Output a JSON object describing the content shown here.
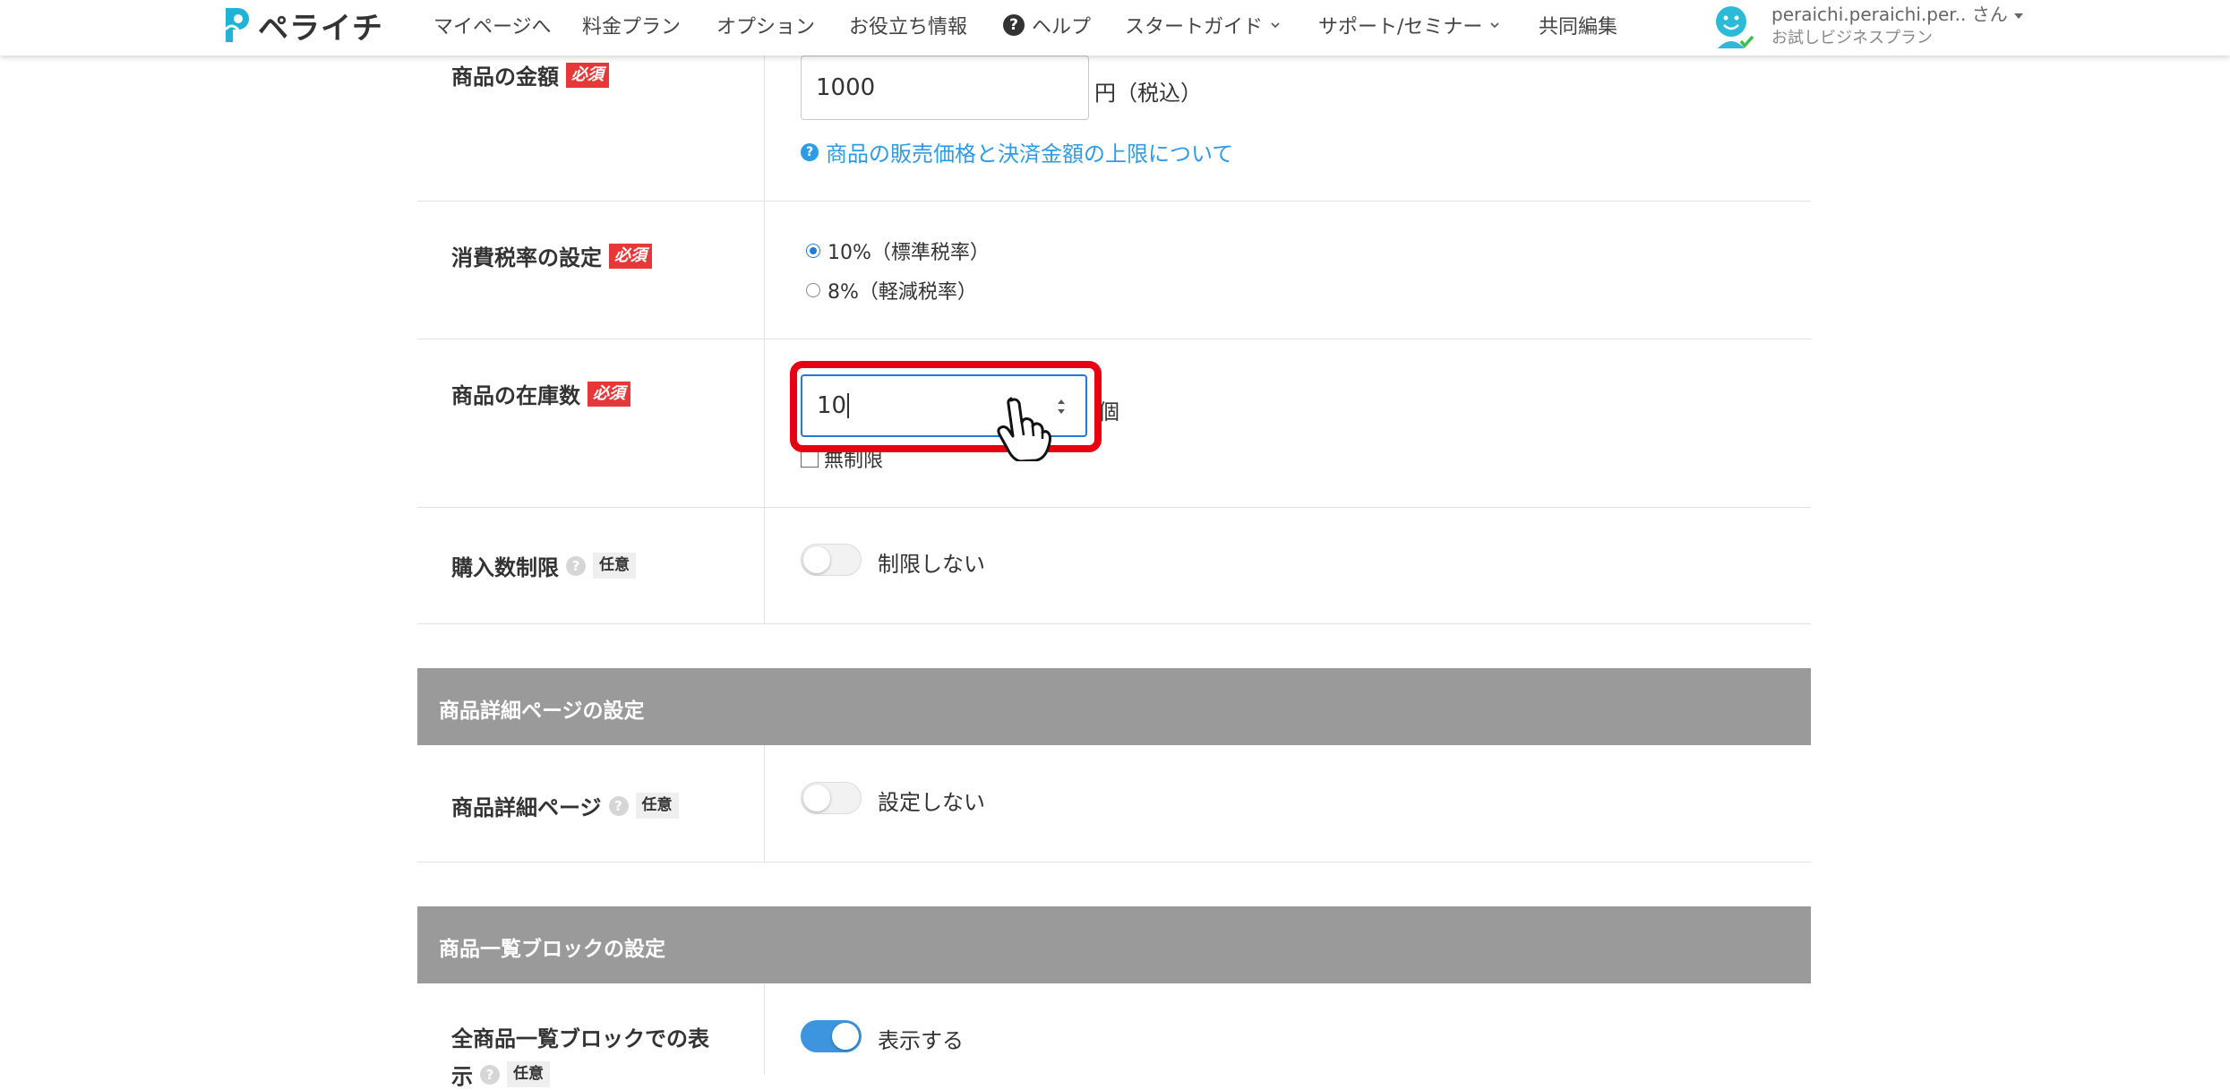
{
  "header": {
    "logo_text": "ペライチ",
    "nav": [
      {
        "label": "マイページへ"
      },
      {
        "label": "料金プラン"
      },
      {
        "label": "オプション"
      },
      {
        "label": "お役立ち情報"
      },
      {
        "label": "ヘルプ"
      },
      {
        "label": "スタートガイド"
      },
      {
        "label": "サポート/セミナー"
      },
      {
        "label": "共同編集"
      }
    ],
    "user_name": "peraichi.peraichi.per.. さん",
    "user_plan": "お試しビジネスプラン"
  },
  "badges": {
    "required": "必須",
    "optional": "任意"
  },
  "form": {
    "price": {
      "label": "商品の金額",
      "value": "1000",
      "unit": "円（税込）",
      "help_link": "商品の販売価格と決済金額の上限について"
    },
    "tax": {
      "label": "消費税率の設定",
      "options": [
        {
          "label": "10%（標準税率）",
          "checked": true
        },
        {
          "label": "8%（軽減税率）",
          "checked": false
        }
      ]
    },
    "stock": {
      "label": "商品の在庫数",
      "value": "10",
      "unit": "個",
      "unlimited_label": "無制限",
      "unlimited_checked": false
    },
    "purchase_limit": {
      "label": "購入数制限",
      "toggle_on": false,
      "toggle_label": "制限しない"
    }
  },
  "sections": [
    {
      "title": "商品詳細ページの設定",
      "field": {
        "label": "商品詳細ページ",
        "toggle_on": false,
        "toggle_label": "設定しない"
      }
    },
    {
      "title": "商品一覧ブロックの設定",
      "field": {
        "label": "全商品一覧ブロックでの表",
        "label_line2": "示",
        "toggle_on": true,
        "toggle_label": "表示する"
      }
    }
  ],
  "colors": {
    "required_badge": "#e63838",
    "link": "#2e9be6",
    "toggle_on": "#3d95e0",
    "section_bar": "#9a9a9a",
    "highlight": "#e60012"
  }
}
